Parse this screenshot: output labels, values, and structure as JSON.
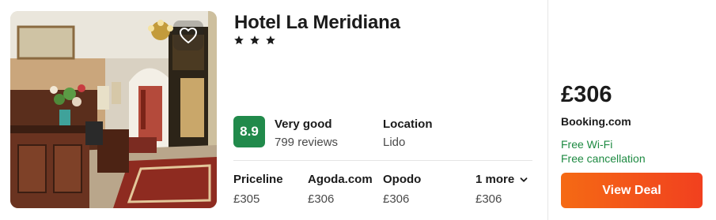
{
  "hotel": {
    "name": "Hotel La Meridiana",
    "star_count": 3,
    "stars_display": "★ ★ ★"
  },
  "photo": {
    "favorite_icon": "heart-outline-icon"
  },
  "rating": {
    "score": "8.9",
    "label": "Very good",
    "reviews": "799 reviews",
    "badge_color": "#218a4b"
  },
  "location": {
    "label": "Location",
    "value": "Lido"
  },
  "providers": [
    {
      "name": "Priceline",
      "price": "£305"
    },
    {
      "name": "Agoda.com",
      "price": "£306"
    },
    {
      "name": "Opodo",
      "price": "£306"
    }
  ],
  "more": {
    "label": "1 more",
    "price": "£306",
    "icon": "chevron-down-icon"
  },
  "deal": {
    "price": "£306",
    "site": "Booking.com",
    "amenities": [
      "Free Wi-Fi",
      "Free cancellation"
    ],
    "amenity_color": "#1e8a42",
    "button_label": "View Deal",
    "button_color": "#f1501a"
  }
}
